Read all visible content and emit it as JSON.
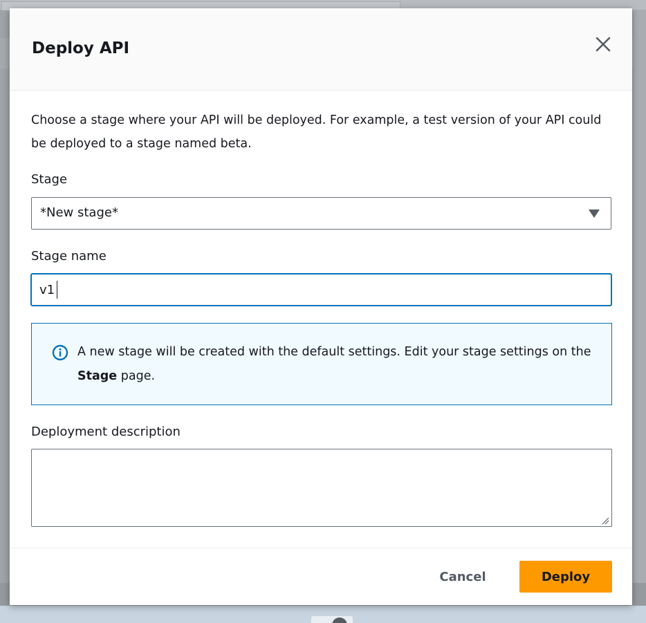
{
  "modal": {
    "title": "Deploy API",
    "description": "Choose a stage where your API will be deployed. For example, a test version of your API could be deployed to a stage named beta."
  },
  "stage": {
    "label": "Stage",
    "selected": "*New stage*"
  },
  "stage_name": {
    "label": "Stage name",
    "value": "v1"
  },
  "info": {
    "text_before": "A new stage will be created with the default settings. Edit your stage settings on the ",
    "bold": "Stage",
    "text_after": " page."
  },
  "deployment_description": {
    "label": "Deployment description",
    "value": ""
  },
  "footer": {
    "cancel_label": "Cancel",
    "deploy_label": "Deploy"
  },
  "colors": {
    "primary_button": "#ff9900",
    "focus_border": "#0073bb",
    "info_background": "#f1faff"
  },
  "icons": {
    "close": "close-icon",
    "info": "info-icon",
    "caret": "caret-down-icon"
  }
}
